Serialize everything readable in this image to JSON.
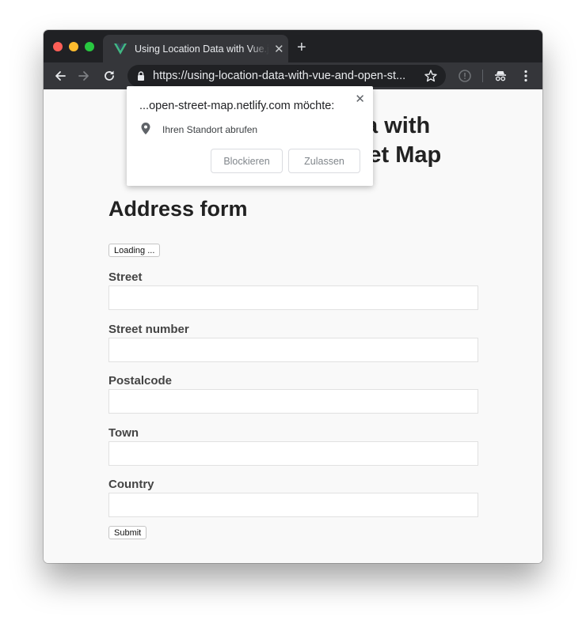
{
  "browser": {
    "tab": {
      "title": "Using Location Data with Vue.js and OpenStreetMap",
      "favicon": "vue-logo-icon"
    },
    "new_tab_label": "+",
    "tab_close_label": "✕",
    "address_bar": {
      "url": "https://using-location-data-with-vue-and-open-st..."
    },
    "colors": {
      "tabstrip": "#202124",
      "toolbar": "#35363a",
      "vue_green": "#41b883"
    }
  },
  "page": {
    "title_line1": "Using Location Data with",
    "title_line2": "Vue.js and OpenStreet Map",
    "form_heading": "Address form",
    "loading_button": "Loading ...",
    "fields": [
      {
        "label": "Street",
        "value": ""
      },
      {
        "label": "Street number",
        "value": ""
      },
      {
        "label": "Postalcode",
        "value": ""
      },
      {
        "label": "Town",
        "value": ""
      },
      {
        "label": "Country",
        "value": ""
      }
    ],
    "submit_button": "Submit"
  },
  "permission_popup": {
    "origin_text": "...open-street-map.netlify.com möchte:",
    "permission": "Ihren Standort abrufen",
    "block_label": "Blockieren",
    "allow_label": "Zulassen",
    "close_label": "✕"
  }
}
